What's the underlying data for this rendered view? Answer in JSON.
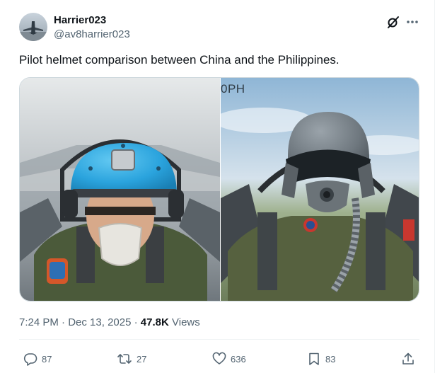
{
  "author": {
    "display_name": "Harrier023",
    "handle": "@av8harrier023"
  },
  "tweet": {
    "text": "Pilot helmet comparison between China and the Philippines.",
    "media_overlay_text": "0PH"
  },
  "meta": {
    "time": "7:24 PM",
    "separator": "·",
    "date": "Dec 13, 2025",
    "views_count": "47.8K",
    "views_label": "Views"
  },
  "actions": {
    "replies": "87",
    "reposts": "27",
    "likes": "636",
    "bookmarks": "83"
  },
  "colors": {
    "text_primary": "#0f1419",
    "text_secondary": "#536471",
    "border": "#cfd9de",
    "china_helmet": "#2fa9e0"
  },
  "icons": [
    "grok-icon",
    "more-icon",
    "reply-icon",
    "repost-icon",
    "like-icon",
    "bookmark-icon",
    "share-icon"
  ]
}
